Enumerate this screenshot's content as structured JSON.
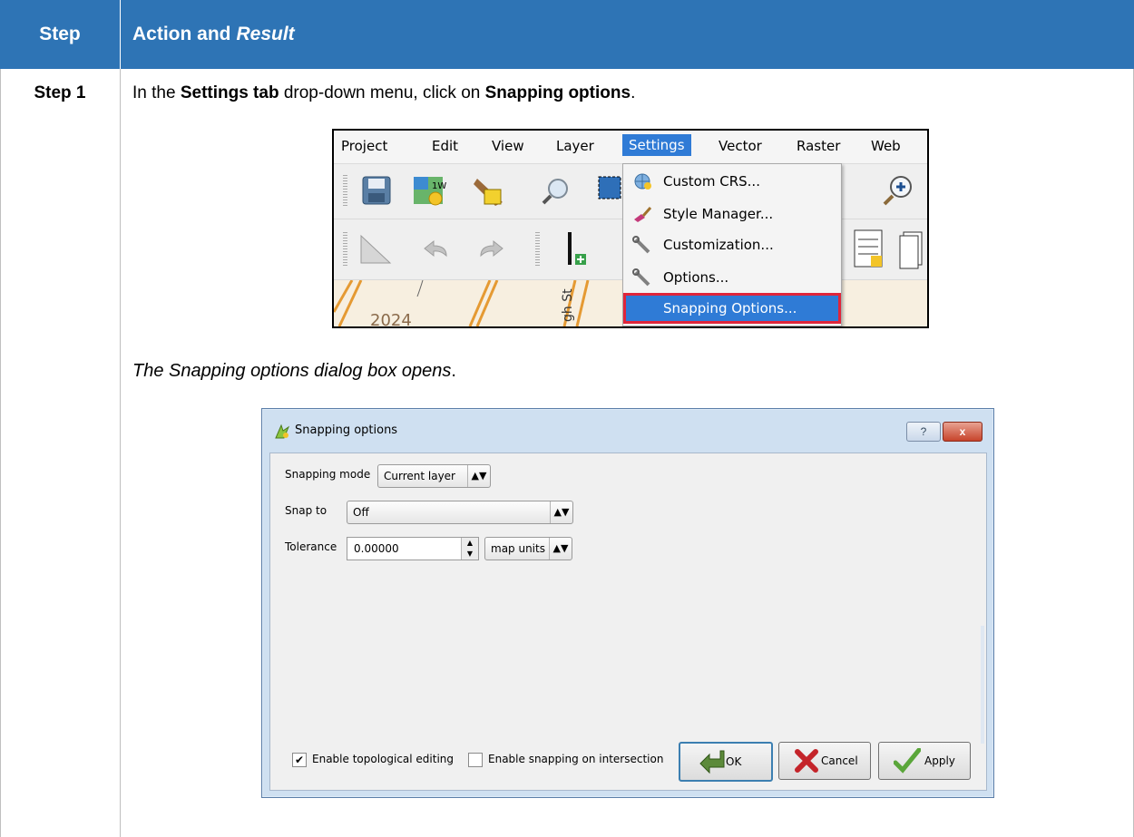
{
  "table": {
    "header_step": "Step",
    "header_action": "Action and",
    "header_result": "Result",
    "step_label": "Step 1",
    "instruction": {
      "part1": "In the ",
      "bold1": "Settings tab",
      "part2": " drop-down menu, click on ",
      "bold2": "Snapping options",
      "part3": "."
    },
    "result_text": "The Snapping options dialog box opens",
    "result_period": "."
  },
  "menu_screenshot": {
    "menubar": [
      "Project",
      "Edit",
      "View",
      "Layer",
      "Settings",
      "Vector",
      "Raster",
      "Web"
    ],
    "selected_menu": "Settings",
    "dropdown_items": [
      {
        "label": "Custom CRS...",
        "icon": "globe-icon"
      },
      {
        "label": "Style Manager...",
        "icon": "paintbrush-icon"
      },
      {
        "label": "Customization...",
        "icon": "wrench-icon"
      },
      {
        "label": "Options...",
        "icon": "wrench-icon"
      },
      {
        "label": "Snapping Options...",
        "icon": "none"
      }
    ],
    "highlighted_item": "Snapping Options...",
    "map_labels": [
      "2024",
      "gh St"
    ]
  },
  "dialog": {
    "title": "Snapping options",
    "help_label": "?",
    "close_label": "x",
    "snapping_mode_label": "Snapping mode",
    "snapping_mode_value": "Current layer",
    "snap_to_label": "Snap to",
    "snap_to_value": "Off",
    "tolerance_label": "Tolerance",
    "tolerance_value": "0.00000",
    "tolerance_units": "map units",
    "enable_topological_label": "Enable topological editing",
    "enable_topological_checked": true,
    "enable_intersection_label": "Enable snapping on intersection",
    "enable_intersection_checked": false,
    "ok_label": "OK",
    "cancel_label": "Cancel",
    "apply_label": "Apply"
  },
  "colors": {
    "header_bg": "#2e74b5",
    "menu_highlight": "#2f7bd6",
    "highlight_outline": "#e0253a"
  }
}
